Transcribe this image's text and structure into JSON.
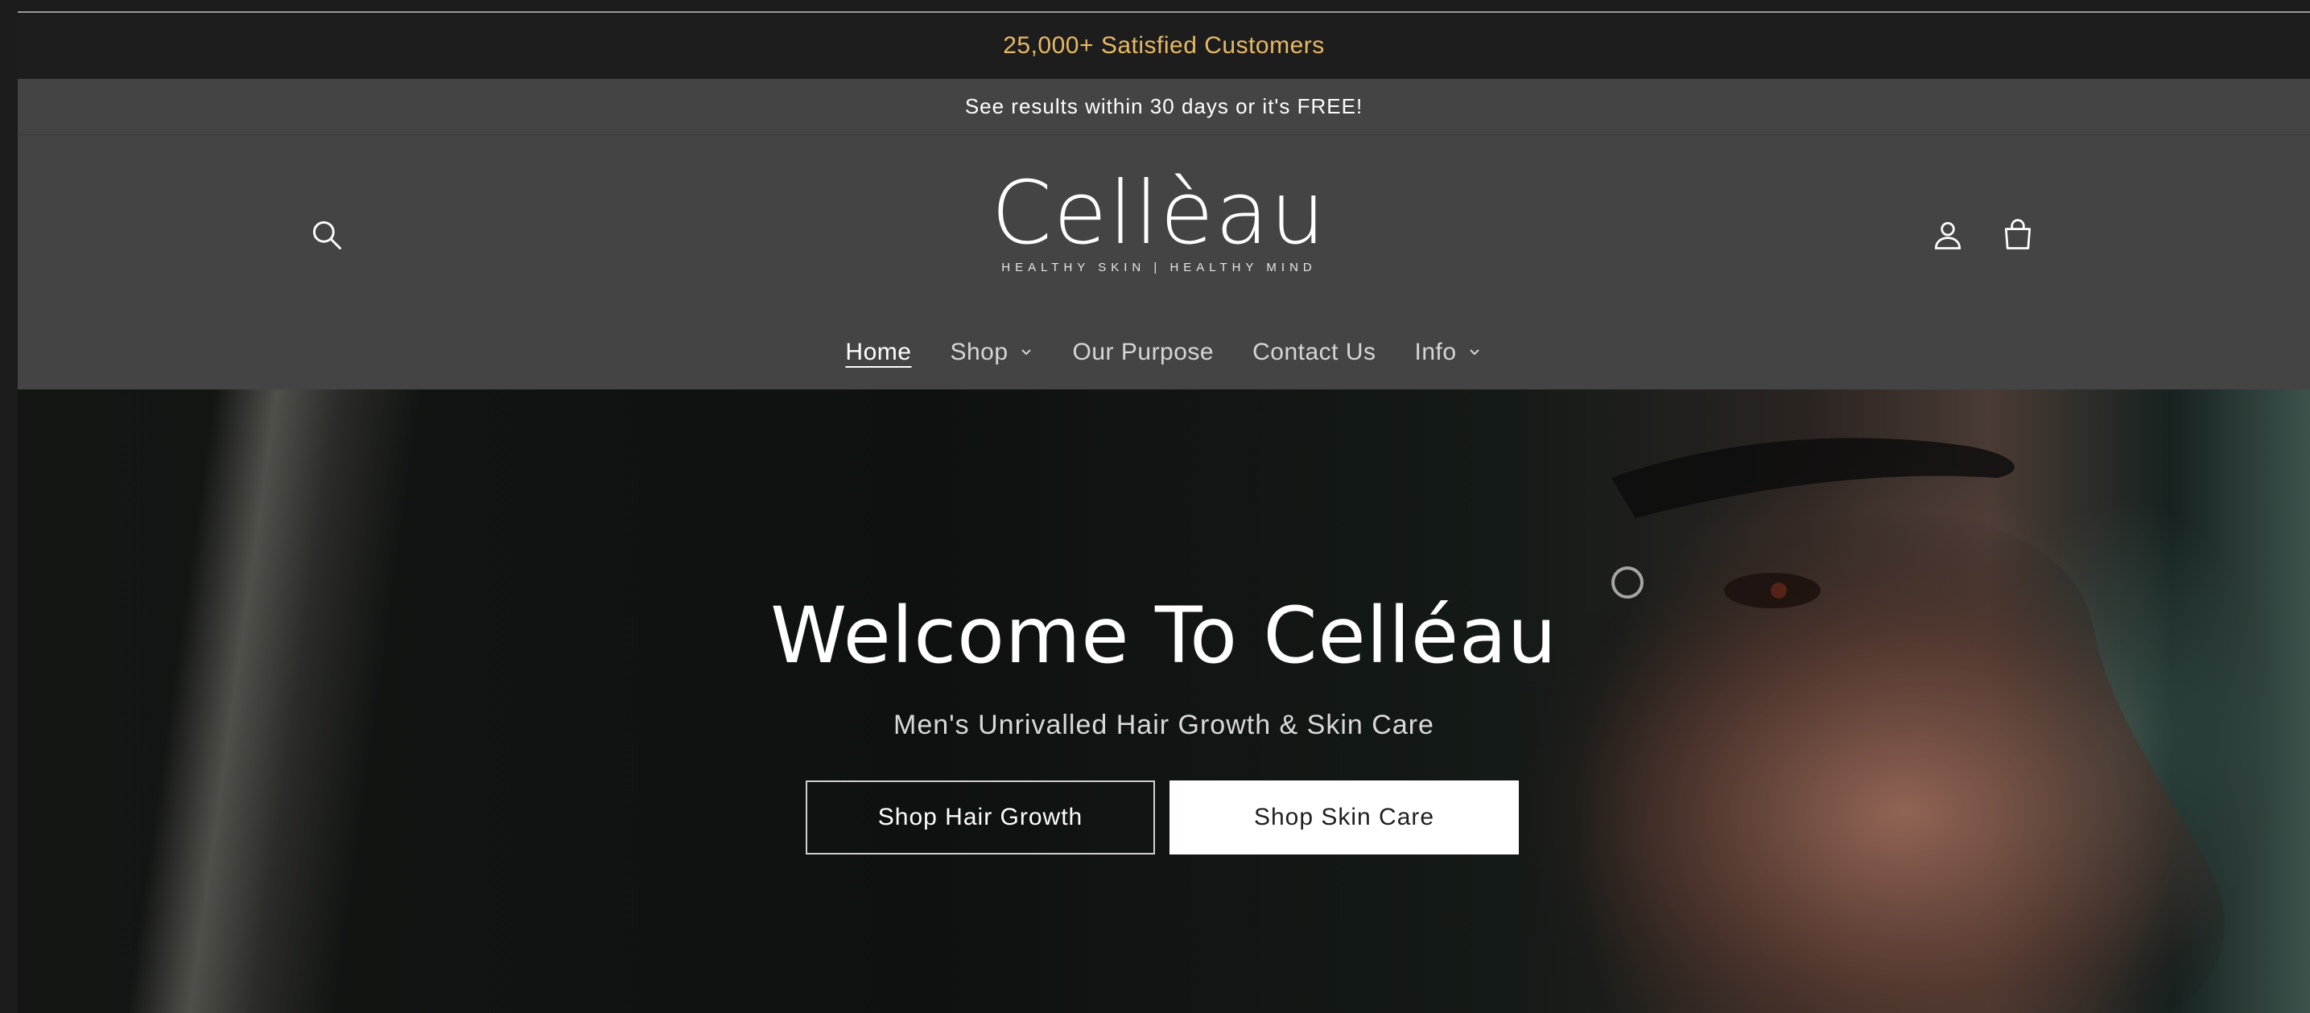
{
  "promo": {
    "text": "25,000+ Satisfied Customers"
  },
  "announcement": {
    "text": "See results within 30 days or it's FREE!"
  },
  "header": {
    "logo_name": "Cellèau",
    "logo_tagline": "HEALTHY SKIN | HEALTHY MIND",
    "icons": {
      "search": "search-icon",
      "account": "user-icon",
      "cart": "cart-icon"
    }
  },
  "nav": {
    "items": [
      {
        "label": "Home",
        "active": true,
        "dropdown": false
      },
      {
        "label": "Shop",
        "active": false,
        "dropdown": true
      },
      {
        "label": "Our Purpose",
        "active": false,
        "dropdown": false
      },
      {
        "label": "Contact Us",
        "active": false,
        "dropdown": false
      },
      {
        "label": "Info",
        "active": false,
        "dropdown": true
      }
    ]
  },
  "hero": {
    "title": "Welcome To Celléau",
    "subtitle": "Men's Unrivalled Hair Growth & Skin Care",
    "buttons": {
      "primary": "Shop Hair Growth",
      "secondary": "Shop Skin Care"
    }
  },
  "colors": {
    "promo_text": "#e7b963",
    "header_bg": "#444444",
    "promo_bg": "#1d1d1d"
  }
}
